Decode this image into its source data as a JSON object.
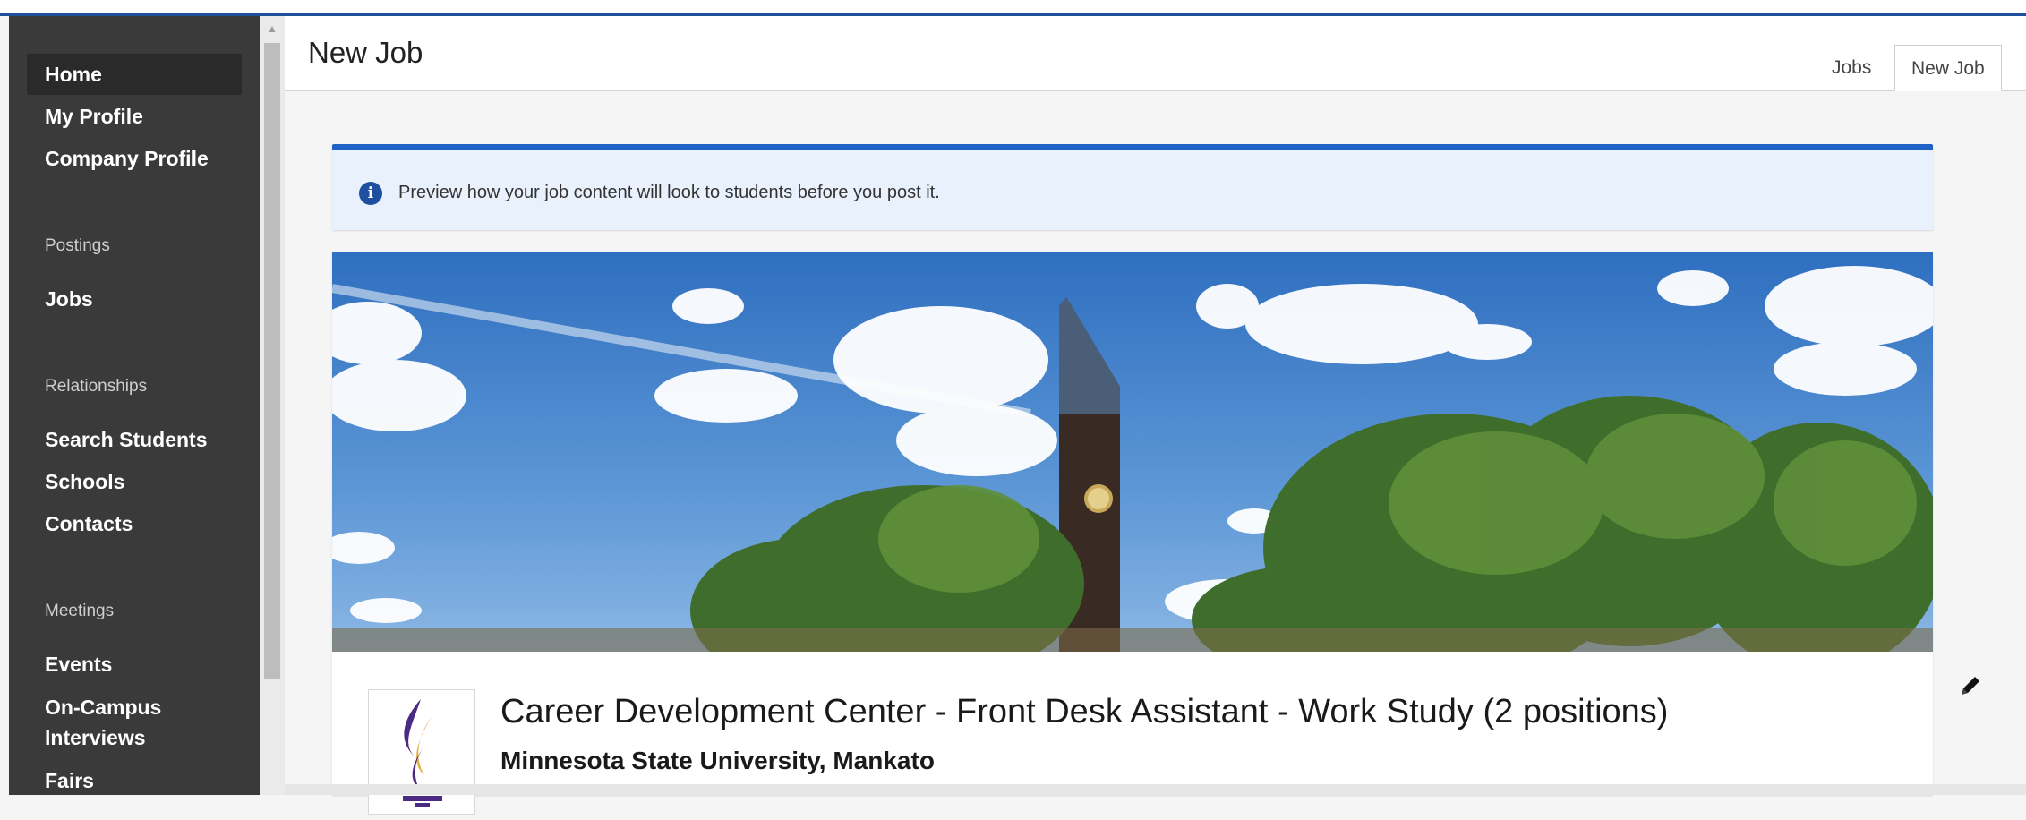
{
  "sidebar": {
    "items": [
      {
        "label": "Home"
      },
      {
        "label": "My Profile"
      },
      {
        "label": "Company Profile"
      }
    ],
    "sections": [
      {
        "heading": "Postings",
        "items": [
          {
            "label": "Jobs"
          }
        ]
      },
      {
        "heading": "Relationships",
        "items": [
          {
            "label": "Search Students"
          },
          {
            "label": "Schools"
          },
          {
            "label": "Contacts"
          }
        ]
      },
      {
        "heading": "Meetings",
        "items": [
          {
            "label": "Events"
          },
          {
            "label": "On-Campus Interviews"
          },
          {
            "label": "Fairs"
          }
        ]
      }
    ]
  },
  "header": {
    "title": "New Job",
    "tabs": [
      {
        "label": "Jobs"
      },
      {
        "label": "New Job"
      }
    ]
  },
  "info": {
    "message": "Preview how your job content will look to students before you post it."
  },
  "job": {
    "title": "Career Development Center - Front Desk Assistant - Work Study (2 positions)",
    "employer": "Minnesota State University, Mankato"
  },
  "icons": {
    "info": "info-icon",
    "edit": "pencil-icon",
    "scroll_up": "scroll-up-arrow-icon"
  },
  "colors": {
    "accent": "#1f4f9f",
    "info_border": "#1f63c7",
    "info_bg": "#e9f1fd",
    "sidebar_bg": "#3a3a3a",
    "logo_purple": "#4b2a85",
    "logo_gold": "#e3b23c"
  }
}
